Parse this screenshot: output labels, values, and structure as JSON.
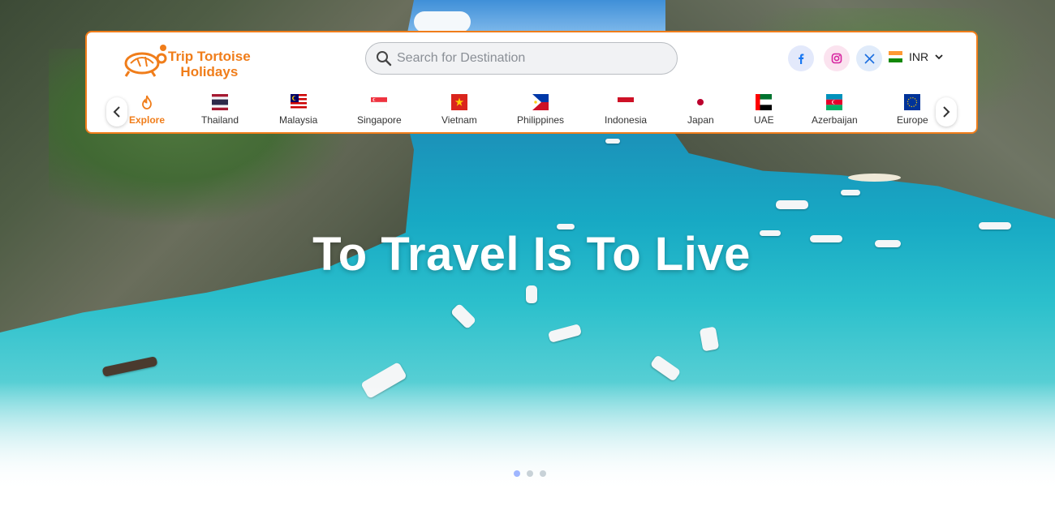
{
  "brand": {
    "name_line1": "Trip Tortoise",
    "name_line2": "Holidays",
    "color": "#f07d1a"
  },
  "search": {
    "placeholder": "Search for Destination",
    "value": ""
  },
  "social": {
    "facebook_icon": "facebook-icon",
    "instagram_icon": "instagram-icon",
    "x_icon": "x-twitter-icon"
  },
  "currency": {
    "code": "INR",
    "flag": "india-flag"
  },
  "destinations": [
    {
      "label": "Explore",
      "icon": "fire-icon"
    },
    {
      "label": "Thailand",
      "icon": "thailand-flag"
    },
    {
      "label": "Malaysia",
      "icon": "malaysia-flag"
    },
    {
      "label": "Singapore",
      "icon": "singapore-flag"
    },
    {
      "label": "Vietnam",
      "icon": "vietnam-flag"
    },
    {
      "label": "Philippines",
      "icon": "philippines-flag"
    },
    {
      "label": "Indonesia",
      "icon": "indonesia-flag"
    },
    {
      "label": "Japan",
      "icon": "japan-flag"
    },
    {
      "label": "UAE",
      "icon": "uae-flag"
    },
    {
      "label": "Azerbaijan",
      "icon": "azerbaijan-flag"
    },
    {
      "label": "Europe",
      "icon": "eu-flag"
    }
  ],
  "hero": {
    "title": "To Travel Is To Live",
    "slides": 3,
    "active_slide": 1
  }
}
